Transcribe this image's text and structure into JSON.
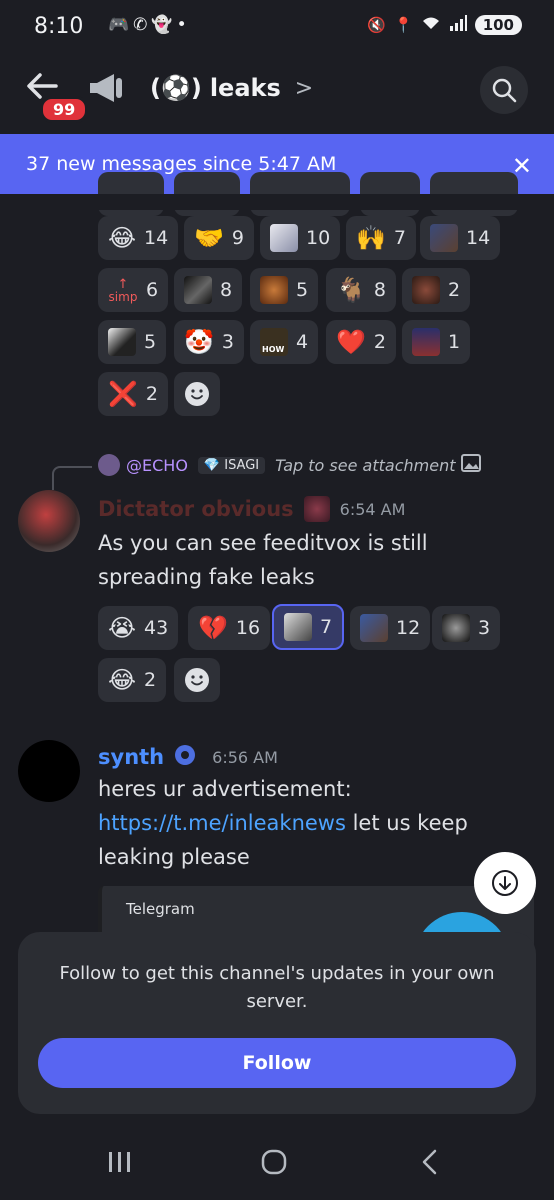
{
  "status_bar": {
    "time": "8:10",
    "battery": "100"
  },
  "header": {
    "back_badge": "99",
    "channel_emoji": "⚽",
    "channel_name": "leaks",
    "chevron": ">"
  },
  "new_messages_banner": {
    "text": "37 new messages since 5:47 AM"
  },
  "reactions_block_1": [
    {
      "emoji": "😂",
      "count": "14"
    },
    {
      "emoji": "🤝",
      "count": "9"
    },
    {
      "emoji": "image",
      "count": "10"
    },
    {
      "emoji": "🙌",
      "count": "7"
    },
    {
      "emoji": "image",
      "count": "14"
    },
    {
      "emoji": "simp",
      "count": "6"
    },
    {
      "emoji": "image",
      "count": "8"
    },
    {
      "emoji": "image",
      "count": "5"
    },
    {
      "emoji": "🐐",
      "count": "8"
    },
    {
      "emoji": "image",
      "count": "2"
    },
    {
      "emoji": "image",
      "count": "5"
    },
    {
      "emoji": "🤡",
      "count": "3"
    },
    {
      "emoji": "image",
      "count": "4"
    },
    {
      "emoji": "❤️",
      "count": "2"
    },
    {
      "emoji": "image",
      "count": "1"
    },
    {
      "emoji": "❌",
      "count": "2"
    }
  ],
  "simp_label": "simp",
  "how_label": "HOW",
  "message_1": {
    "reply": {
      "name": "@ECHO",
      "tag": "ISAGI",
      "text": "Tap to see attachment"
    },
    "author": "Dictator obvious",
    "timestamp": "6:54 AM",
    "text_line_1": "As you can see feeditvox is still",
    "text_line_2": "spreading fake leaks",
    "reactions": [
      {
        "emoji": "😭",
        "count": "43"
      },
      {
        "emoji": "💔",
        "count": "16"
      },
      {
        "emoji": "image",
        "count": "7"
      },
      {
        "emoji": "image",
        "count": "12"
      },
      {
        "emoji": "image",
        "count": "3"
      },
      {
        "emoji": "😂",
        "count": "2"
      }
    ]
  },
  "message_2": {
    "author": "synth",
    "timestamp": "6:56 AM",
    "text_line_1": "heres ur advertisement:",
    "link": "https://t.me/inleaknews",
    "text_after_link": " let us keep",
    "text_line_3": "leaking please",
    "embed_provider": "Telegram"
  },
  "follow_card": {
    "text": "Follow to get this channel's updates in your own server.",
    "button": "Follow"
  },
  "colors": {
    "accent": "#5865f2",
    "background": "#1c1d23",
    "link": "#4da3ff",
    "author_synth": "#4d8fff",
    "author_dictator": "#5a2a2a"
  }
}
